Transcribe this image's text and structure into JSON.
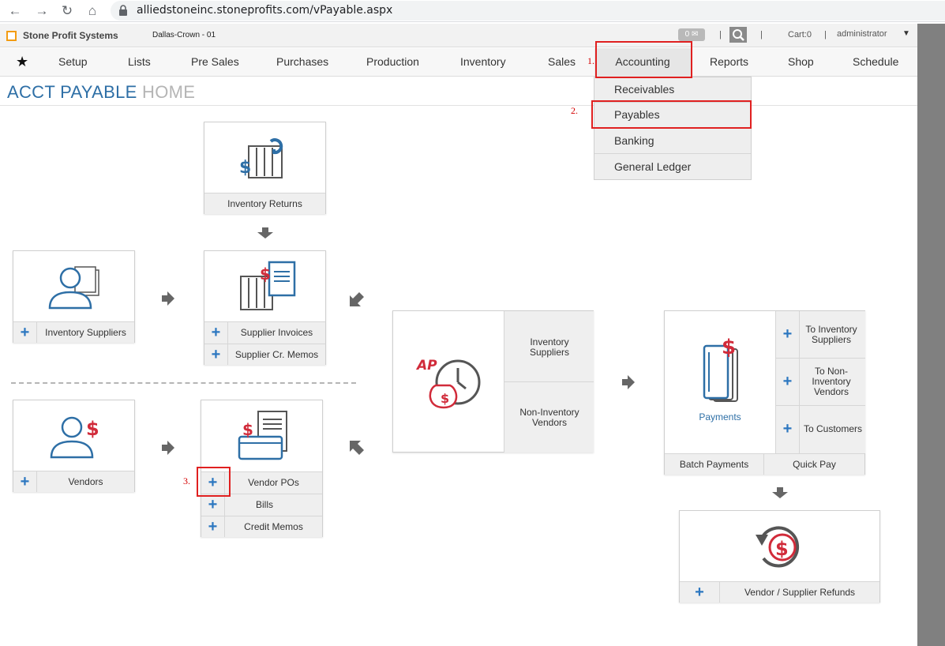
{
  "browser": {
    "url": "alliedstoneinc.stoneprofits.com/vPayable.aspx"
  },
  "header": {
    "company": "Stone Profit Systems",
    "branch": "Dallas-Crown - 01",
    "messages": "0",
    "cart": "Cart:0",
    "user": "administrator"
  },
  "nav": {
    "items": [
      "Setup",
      "Lists",
      "Pre Sales",
      "Purchases",
      "Production",
      "Inventory",
      "Sales",
      "Accounting",
      "Reports",
      "Shop",
      "Schedule"
    ]
  },
  "dropdown": {
    "items": [
      "Receivables",
      "Payables",
      "Banking",
      "General Ledger"
    ]
  },
  "annotations": {
    "step1": "1.",
    "step2": "2.",
    "step3": "3."
  },
  "page": {
    "title_main": "ACCT PAYABLE",
    "title_sub": "HOME"
  },
  "cards": {
    "inventory_returns": "Inventory Returns",
    "inventory_suppliers": "Inventory Suppliers",
    "supplier_invoices": "Supplier Invoices",
    "supplier_cr_memos": "Supplier Cr. Memos",
    "vendors": "Vendors",
    "vendor_pos": "Vendor POs",
    "bills": "Bills",
    "credit_memos": "Credit Memos",
    "ap_inventory_suppliers": "Inventory Suppliers",
    "ap_non_inventory_vendors": "Non-Inventory Vendors",
    "payments": "Payments",
    "to_inventory_suppliers": "To Inventory Suppliers",
    "to_non_inventory_vendors": "To Non-Inventory Vendors",
    "to_customers": "To Customers",
    "batch_payments": "Batch Payments",
    "quick_pay": "Quick Pay",
    "refunds": "Vendor / Supplier Refunds",
    "plus": "+",
    "ap_icon_text": "AP"
  },
  "colors": {
    "accent_blue": "#2e6fa6",
    "icon_red": "#d12b3a",
    "highlight_red": "#e02020"
  }
}
